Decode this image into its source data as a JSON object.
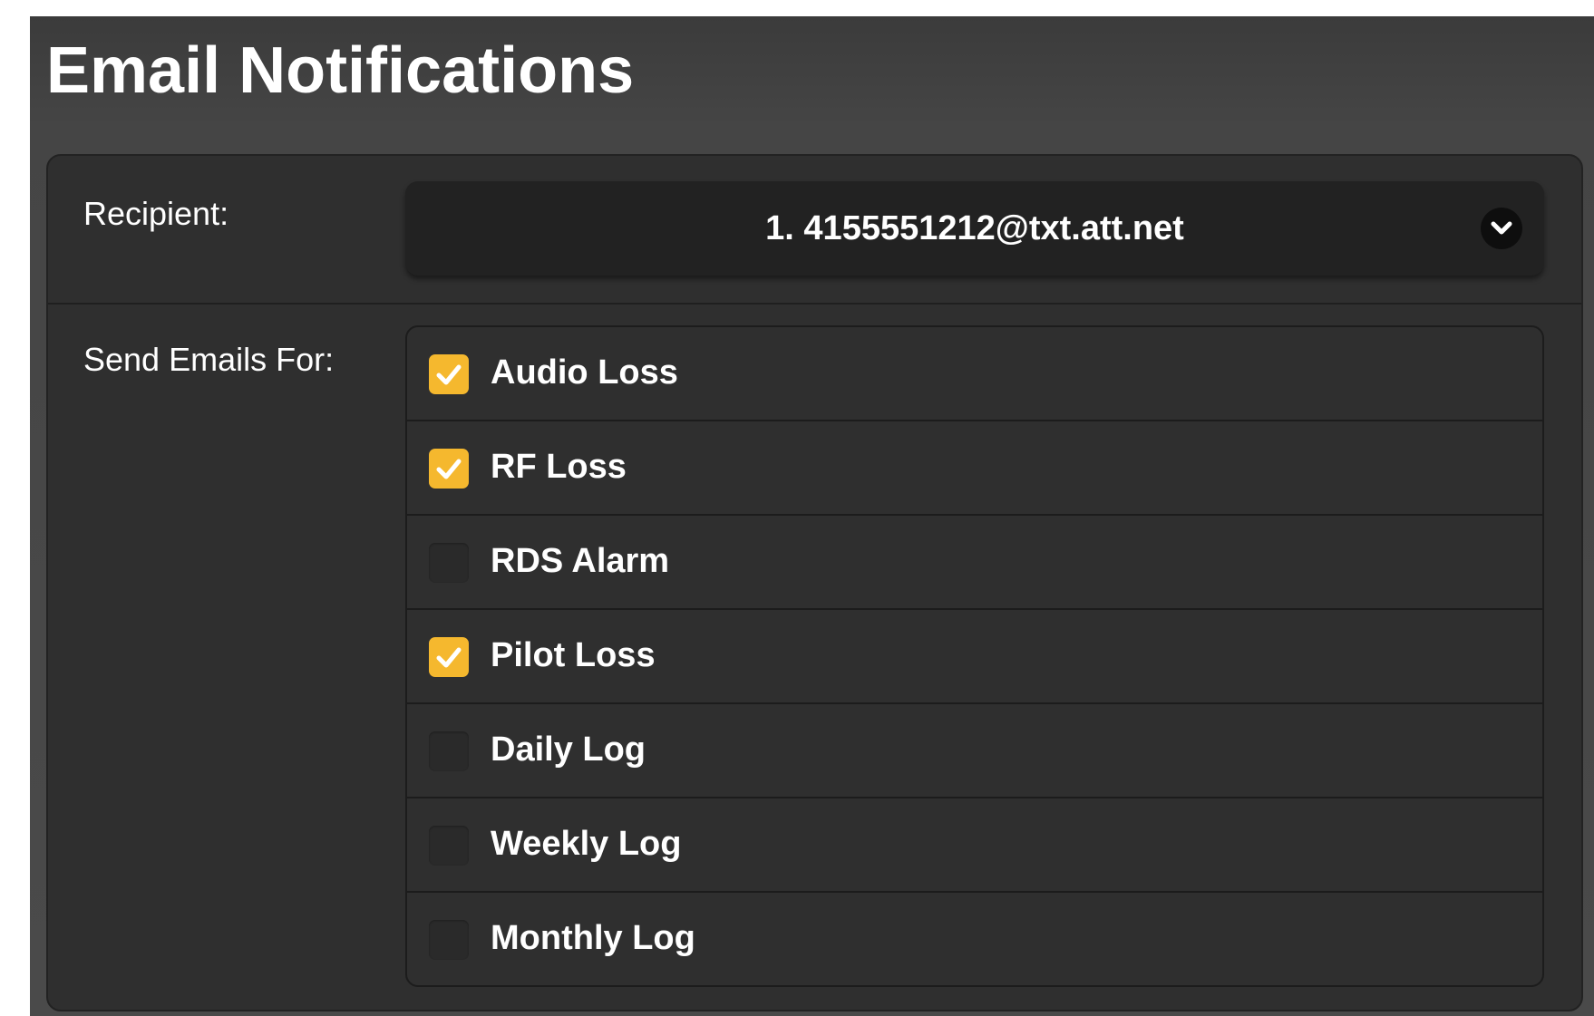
{
  "page": {
    "title": "Email Notifications"
  },
  "recipient": {
    "label": "Recipient:",
    "selected": "1. 4155551212@txt.att.net",
    "icon": "chevron-down-icon"
  },
  "send_emails": {
    "label": "Send Emails For:",
    "items": [
      {
        "label": "Audio Loss",
        "checked": true
      },
      {
        "label": "RF Loss",
        "checked": true
      },
      {
        "label": "RDS Alarm",
        "checked": false
      },
      {
        "label": "Pilot Loss",
        "checked": true
      },
      {
        "label": "Daily Log",
        "checked": false
      },
      {
        "label": "Weekly Log",
        "checked": false
      },
      {
        "label": "Monthly Log",
        "checked": false
      }
    ]
  },
  "colors": {
    "checked_fill": "#f5b82e",
    "unchecked_fill": "#2a2a2a",
    "panel": "#2f2f2f",
    "select_bg": "#222222"
  }
}
